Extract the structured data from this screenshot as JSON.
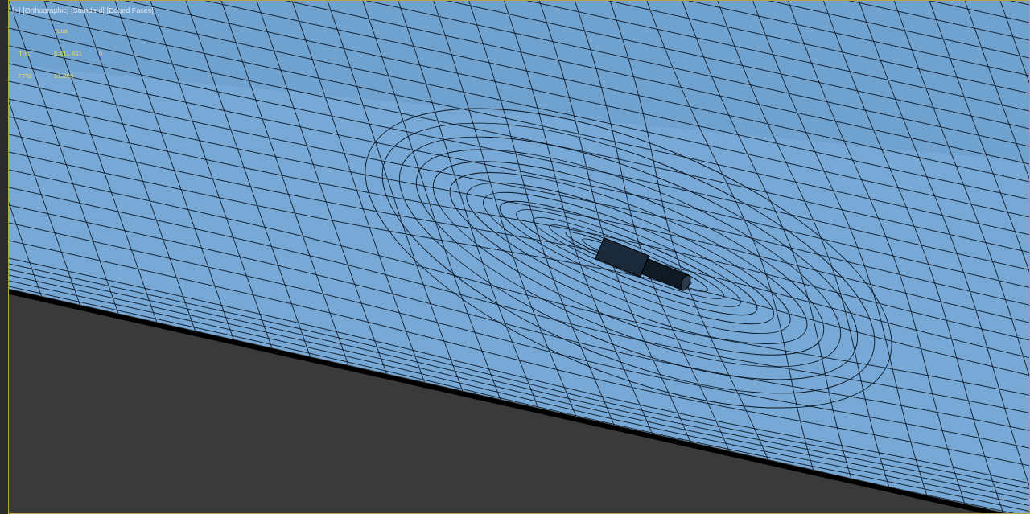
{
  "viewport": {
    "labels": [
      "[+]",
      "[Orthographic]",
      "[Standard]",
      "[Edged Faces]"
    ],
    "stats": {
      "heading": "Total",
      "rows": [
        {
          "label": "Tris:",
          "values": [
            "6,811,431",
            "0"
          ]
        },
        {
          "label": "FPS:",
          "values": [
            "61,895"
          ]
        }
      ]
    }
  }
}
